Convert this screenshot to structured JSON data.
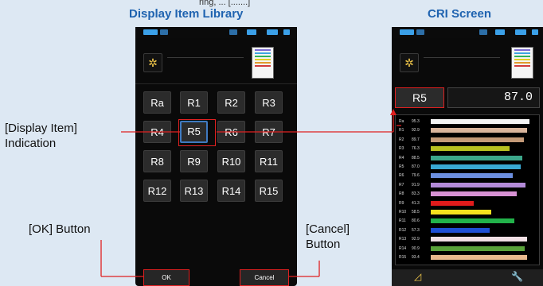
{
  "top_cut_text": "ring, ...            [.......]",
  "titles": {
    "left": "Display Item Library",
    "right": "CRI Screen"
  },
  "annotations": {
    "display_item_line1": "[Display Item]",
    "display_item_line2": "Indication",
    "ok_button": "[OK] Button",
    "cancel_line1": "[Cancel]",
    "cancel_line2": "Button"
  },
  "left_device": {
    "items": [
      "Ra",
      "R1",
      "R2",
      "R3",
      "R4",
      "R5",
      "R6",
      "R7",
      "R8",
      "R9",
      "R10",
      "R11",
      "R12",
      "R13",
      "R14",
      "R15"
    ],
    "selected": "R5",
    "ok_label": "OK",
    "cancel_label": "Cancel"
  },
  "right_device": {
    "item_label": "R5",
    "item_value": "87.0",
    "bars": [
      {
        "label": "Ra",
        "value": "95.3",
        "pct": 0.953,
        "color": "#f4f4f4"
      },
      {
        "label": "R1",
        "value": "92.9",
        "pct": 0.929,
        "color": "#d9b59c"
      },
      {
        "label": "R2",
        "value": "89.7",
        "pct": 0.897,
        "color": "#c49a78"
      },
      {
        "label": "R3",
        "value": "76.3",
        "pct": 0.763,
        "color": "#b7c020"
      },
      {
        "label": "R4",
        "value": "88.5",
        "pct": 0.885,
        "color": "#3ca68a"
      },
      {
        "label": "R5",
        "value": "87.0",
        "pct": 0.87,
        "color": "#39a9d4"
      },
      {
        "label": "R6",
        "value": "79.6",
        "pct": 0.796,
        "color": "#6c8fe0"
      },
      {
        "label": "R7",
        "value": "91.9",
        "pct": 0.919,
        "color": "#b38ad8"
      },
      {
        "label": "R8",
        "value": "83.3",
        "pct": 0.833,
        "color": "#d792d4"
      },
      {
        "label": "R9",
        "value": "41.3",
        "pct": 0.413,
        "color": "#e01b1b"
      },
      {
        "label": "R10",
        "value": "58.5",
        "pct": 0.585,
        "color": "#f5e11e"
      },
      {
        "label": "R11",
        "value": "80.6",
        "pct": 0.806,
        "color": "#22b24a"
      },
      {
        "label": "R12",
        "value": "57.3",
        "pct": 0.573,
        "color": "#1e4fd4"
      },
      {
        "label": "R13",
        "value": "92.9",
        "pct": 0.929,
        "color": "#f1dfe4"
      },
      {
        "label": "R14",
        "value": "90.9",
        "pct": 0.909,
        "color": "#5aa23a"
      },
      {
        "label": "R15",
        "value": "93.4",
        "pct": 0.934,
        "color": "#e8b98e"
      }
    ],
    "footer_left_icon": "triangle-ruler-icon",
    "footer_right_icon": "wrench-icon"
  },
  "colors": {
    "title": "#1f63b0",
    "callout": "#e02020",
    "selected_border": "#3f7ac0"
  }
}
